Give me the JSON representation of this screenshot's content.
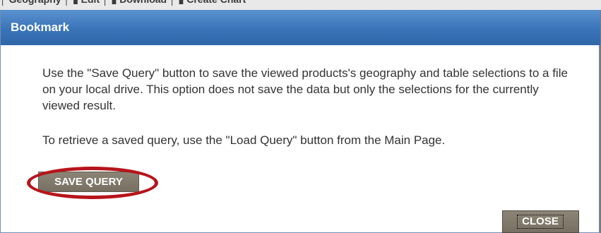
{
  "background_page": {
    "tabs_text": "│  Geography  │  ▮ Edit  │  ▮ Download  │  ▮ Create Chart"
  },
  "dialog": {
    "title": "Bookmark",
    "paragraph1": "Use the \"Save Query\" button to save the viewed products's geography and table selections to a file on your local drive. This option does not save the data but only the selections for the currently viewed result.",
    "paragraph2": "To retrieve a saved query, use the \"Load Query\" button from the Main Page.",
    "save_button": "SAVE QUERY",
    "close_button": "CLOSE"
  },
  "colors": {
    "title_bar": "#3a74b8",
    "button_bg": "#817a6c",
    "highlight": "#b7141b"
  }
}
